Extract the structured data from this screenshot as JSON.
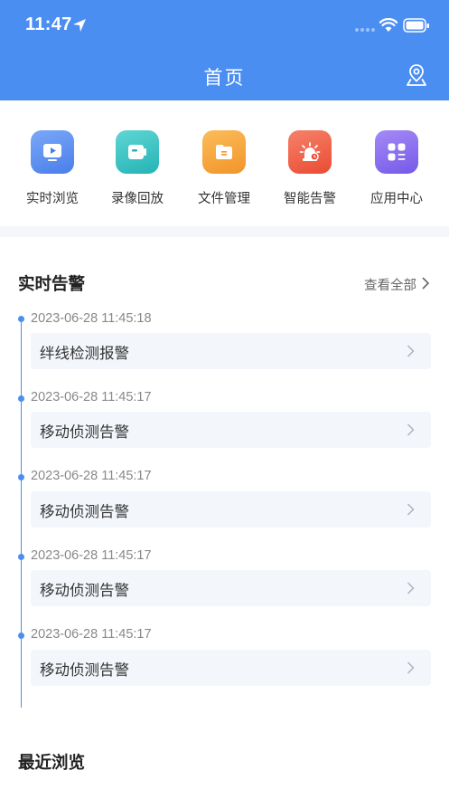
{
  "status_bar": {
    "time": "11:47"
  },
  "header": {
    "title": "首页"
  },
  "shortcuts": [
    {
      "label": "实时浏览",
      "icon": "play-video-icon",
      "color": "#5b8ef0"
    },
    {
      "label": "录像回放",
      "icon": "camera-recording-icon",
      "color": "#37c4c4"
    },
    {
      "label": "文件管理",
      "icon": "folder-icon",
      "color": "#f6a33c"
    },
    {
      "label": "智能告警",
      "icon": "alarm-light-icon",
      "color": "#f2593f"
    },
    {
      "label": "应用中心",
      "icon": "apps-grid-icon",
      "color": "#8a6cf0"
    }
  ],
  "alerts": {
    "title": "实时告警",
    "view_all": "查看全部",
    "items": [
      {
        "time": "2023-06-28 11:45:18",
        "name": "绊线检测报警"
      },
      {
        "time": "2023-06-28 11:45:17",
        "name": "移动侦测告警"
      },
      {
        "time": "2023-06-28 11:45:17",
        "name": "移动侦测告警"
      },
      {
        "time": "2023-06-28 11:45:17",
        "name": "移动侦测告警"
      },
      {
        "time": "2023-06-28 11:45:17",
        "name": "移动侦测告警"
      }
    ]
  },
  "recent": {
    "title": "最近浏览"
  },
  "colors": {
    "primary": "#4b8ef2",
    "card_bg": "#f3f6fb"
  }
}
